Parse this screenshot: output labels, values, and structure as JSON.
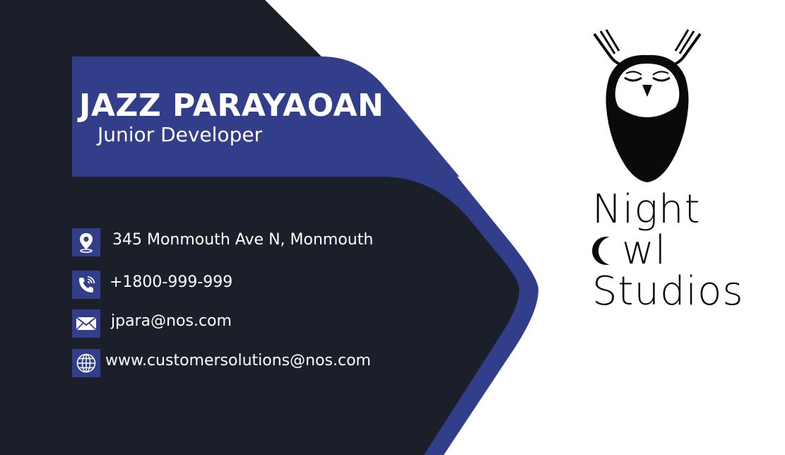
{
  "card": {
    "name": "JAZZ PARAYAOAN",
    "title": "Junior Developer"
  },
  "contacts": [
    {
      "icon": "location-pin-icon",
      "text": "345 Monmouth Ave N, Monmouth"
    },
    {
      "icon": "phone-icon",
      "text": "+1800-999-999"
    },
    {
      "icon": "envelope-icon",
      "text": "jpara@nos.com"
    },
    {
      "icon": "globe-icon",
      "text": "www.customersolutions@nos.com"
    }
  ],
  "brand": {
    "line1": "Night",
    "line2_rest": "wl",
    "line3": "Studios"
  },
  "colors": {
    "dark_bg": "#1b1f29",
    "accent_blue": "#333e8a",
    "white": "#ffffff",
    "logo_black": "#0a0a0a"
  }
}
